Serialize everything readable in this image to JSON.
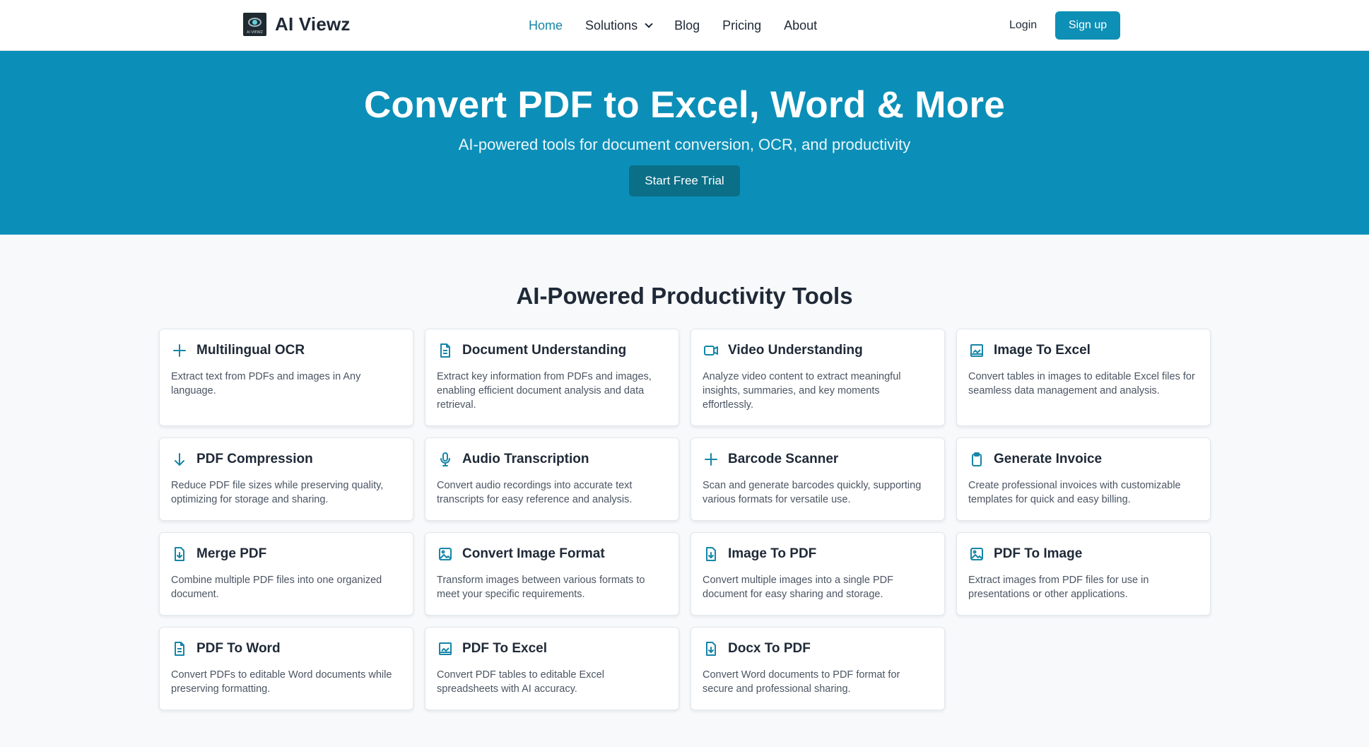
{
  "header": {
    "brand_name": "AI Viewz",
    "logo_text": "AI VIEWZ",
    "nav": [
      {
        "label": "Home",
        "active": true
      },
      {
        "label": "Solutions",
        "has_dropdown": true
      },
      {
        "label": "Blog"
      },
      {
        "label": "Pricing"
      },
      {
        "label": "About"
      }
    ],
    "login_label": "Login",
    "signup_label": "Sign up"
  },
  "hero": {
    "title": "Convert PDF to Excel, Word & More",
    "subtitle": "AI-powered tools for document conversion, OCR, and productivity",
    "cta_label": "Start Free Trial"
  },
  "tools_section": {
    "title": "AI-Powered Productivity Tools",
    "cards": [
      {
        "icon": "plus-icon",
        "title": "Multilingual OCR",
        "desc": "Extract text from PDFs and images in Any language."
      },
      {
        "icon": "document-icon",
        "title": "Document Understanding",
        "desc": "Extract key information from PDFs and images, enabling efficient document analysis and data retrieval."
      },
      {
        "icon": "video-camera-icon",
        "title": "Video Understanding",
        "desc": "Analyze video content to extract meaningful insights, summaries, and key moments effortlessly."
      },
      {
        "icon": "table-image-icon",
        "title": "Image To Excel",
        "desc": "Convert tables in images to editable Excel files for seamless data management and analysis."
      },
      {
        "icon": "arrow-down-icon",
        "title": "PDF Compression",
        "desc": "Reduce PDF file sizes while preserving quality, optimizing for storage and sharing."
      },
      {
        "icon": "microphone-icon",
        "title": "Audio Transcription",
        "desc": "Convert audio recordings into accurate text transcripts for easy reference and analysis."
      },
      {
        "icon": "plus-icon",
        "title": "Barcode Scanner",
        "desc": "Scan and generate barcodes quickly, supporting various formats for versatile use."
      },
      {
        "icon": "clipboard-icon",
        "title": "Generate Invoice",
        "desc": "Create professional invoices with customizable templates for quick and easy billing."
      },
      {
        "icon": "file-download-icon",
        "title": "Merge PDF",
        "desc": "Combine multiple PDF files into one organized document."
      },
      {
        "icon": "image-icon",
        "title": "Convert Image Format",
        "desc": "Transform images between various formats to meet your specific requirements."
      },
      {
        "icon": "file-download-icon",
        "title": "Image To PDF",
        "desc": "Convert multiple images into a single PDF document for easy sharing and storage."
      },
      {
        "icon": "image-icon",
        "title": "PDF To Image",
        "desc": "Extract images from PDF files for use in presentations or other applications."
      },
      {
        "icon": "document-icon",
        "title": "PDF To Word",
        "desc": "Convert PDFs to editable Word documents while preserving formatting."
      },
      {
        "icon": "table-image-icon",
        "title": "PDF To Excel",
        "desc": "Convert PDF tables to editable Excel spreadsheets with AI accuracy."
      },
      {
        "icon": "file-download-icon",
        "title": "Docx To PDF",
        "desc": "Convert Word documents to PDF format for secure and professional sharing."
      }
    ]
  },
  "colors": {
    "primary": "#0b8fb8",
    "cta_dark": "#0b6f88",
    "nav_active": "#1586a8",
    "icon": "#1586a8"
  }
}
